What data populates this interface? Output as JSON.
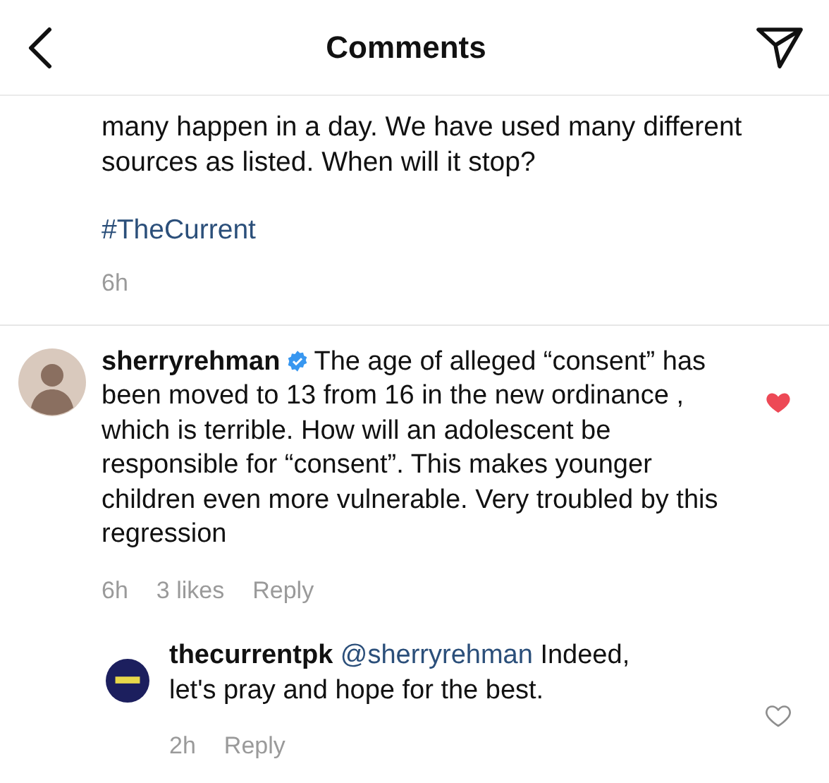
{
  "header": {
    "title": "Comments"
  },
  "post": {
    "caption": "many happen in a day. We have used many different sources as listed. When will it stop?",
    "hashtag": "#TheCurrent",
    "time": "6h"
  },
  "comments": [
    {
      "username": "sherryrehman",
      "verified": true,
      "text": "The age of alleged “consent” has been moved to 13 from 16 in the new ordinance , which is terrible. How will an adolescent be responsible for “consent”. This makes younger children even more vulnerable. Very troubled by this regression",
      "liked": true,
      "time": "6h",
      "likes": "3 likes",
      "reply_label": "Reply",
      "replies": [
        {
          "username": "thecurrentpk",
          "verified": false,
          "mention": "@sherryrehman",
          "text": "Indeed, let's pray and hope for the best.",
          "liked": false,
          "time": "2h",
          "reply_label": "Reply"
        }
      ]
    }
  ]
}
